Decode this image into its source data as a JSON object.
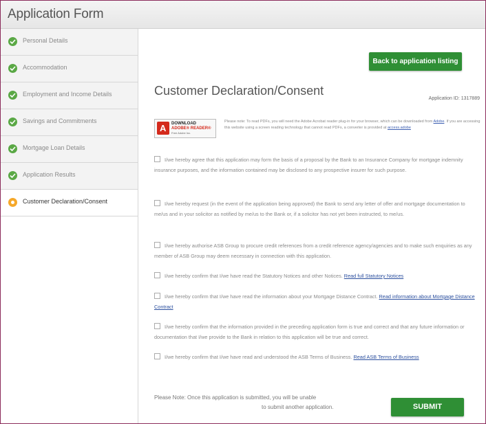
{
  "header": {
    "title": "Application Form"
  },
  "sidebar": {
    "items": [
      {
        "label": "Personal Details",
        "status": "complete"
      },
      {
        "label": "Accommodation",
        "status": "complete"
      },
      {
        "label": "Employment and Income Details",
        "status": "complete"
      },
      {
        "label": "Savings and Commitments",
        "status": "complete"
      },
      {
        "label": "Mortgage Loan Details",
        "status": "complete"
      },
      {
        "label": "Application Results",
        "status": "complete"
      },
      {
        "label": "Customer Declaration/Consent",
        "status": "current"
      }
    ]
  },
  "main": {
    "back_button": "Back to application listing",
    "title": "Customer Declaration/Consent",
    "application_id": "Application ID: 1317889",
    "adobe": {
      "line1": "DOWNLOAD",
      "line2": "ADOBE® READER®",
      "line3": "Free Adobe Inc.",
      "note_part1": "Please note: To read PDFs, you will need the Adobe Acrobat reader plug-in for your browser, which can be downloaded from",
      "link1": "Adobe",
      "note_part2": ". If you are accessing this website using a screen reading technology that cannot read PDFs, a converter is provided at",
      "link2": "access.adobe"
    },
    "declarations": [
      {
        "text": "I/we hereby agree that this application may form the basis of a proposal by the Bank to an Insurance Company for mortgage indemnity insurance purposes, and the information contained may be disclosed to any prospective insurer for such purpose.",
        "link": ""
      },
      {
        "text": "I/we hereby request (in the event of the application being approved) the Bank to send any letter of offer and mortgage documentation to me/us and in your solicitor as notified by me/us to the Bank or, if a solicitor has not yet been instructed, to me/us.",
        "link": ""
      },
      {
        "text": "I/we hereby authorise ASB Group to procure credit references from a credit reference agency/agencies and to make such enquiries as any member of ASB Group may deem necessary in connection with this application.",
        "link": ""
      },
      {
        "text": "I/we hereby confirm that I/we have read the Statutory Notices and other Notices.",
        "link": "Read full Statutory Notices"
      },
      {
        "text": "I/we hereby confirm that I/we have read the information about your Mortgage Distance Contract.",
        "link": "Read information about Mortgage Distance Contract"
      },
      {
        "text": "I/we hereby confirm that the information provided in the preceding application form is true and correct and that any future information or documentation that I/we provide to the Bank in relation to this application will be true and correct.",
        "link": ""
      },
      {
        "text": "I/we hereby confirm that I/we have read and understood the ASB Terms of Business.",
        "link": "Read ASB Terms of Business"
      }
    ],
    "note_line1": "Please Note: Once this application is submitted, you will be unable",
    "note_line2": "to submit another application.",
    "submit_button": "SUBMIT"
  },
  "colors": {
    "accent_green": "#2f8f35",
    "check_green": "#5aa845",
    "current_orange": "#f5a82a",
    "frame_border": "#8a2a5a"
  },
  "icons": {
    "complete": "check-circle-icon",
    "current": "current-step-icon",
    "adobe": "adobe-reader-icon"
  }
}
